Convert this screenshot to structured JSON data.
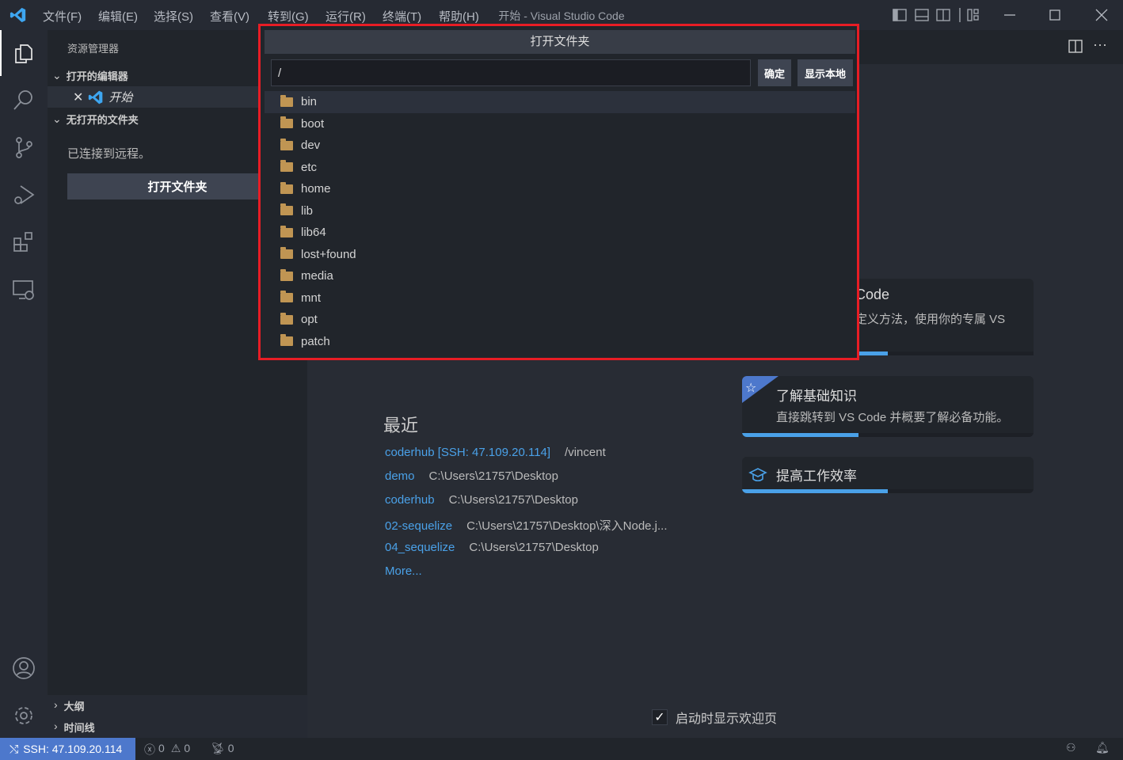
{
  "titlebar": {
    "menus": [
      "文件(F)",
      "编辑(E)",
      "选择(S)",
      "查看(V)",
      "转到(G)",
      "运行(R)",
      "终端(T)",
      "帮助(H)"
    ],
    "title": "开始 - Visual Studio Code"
  },
  "sidebar": {
    "title": "资源管理器",
    "open_editors": "打开的编辑器",
    "open_file": "开始",
    "no_folder": "无打开的文件夹",
    "connected": "已连接到远程。",
    "open_folder_btn": "打开文件夹",
    "outline": "大纲",
    "timeline": "时间线"
  },
  "dialog": {
    "title": "打开文件夹",
    "path": "/",
    "ok": "确定",
    "show_local": "显示本地",
    "items": [
      "bin",
      "boot",
      "dev",
      "etc",
      "home",
      "lib",
      "lib64",
      "lost+found",
      "media",
      "mnt",
      "opt",
      "patch"
    ]
  },
  "welcome": {
    "recent_title": "最近",
    "recent": [
      {
        "name": "coderhub [SSH: 47.109.20.114]",
        "path": "/vincent"
      },
      {
        "name": "demo",
        "path": "C:\\Users\\21757\\Desktop"
      },
      {
        "name": "coderhub",
        "path": "C:\\Users\\21757\\Desktop"
      },
      {
        "name": "02-sequelize",
        "path": "C:\\Users\\21757\\Desktop\\深入Node.j..."
      },
      {
        "name": "04_sequelize",
        "path": "C:\\Users\\21757\\Desktop"
      }
    ],
    "more": "More...",
    "cards": [
      {
        "title": "Code",
        "desc": "定义方法，使用你的专属 VS",
        "progress": 0.5
      },
      {
        "title": "了解基础知识",
        "desc": "直接跳转到 VS Code 并概要了解必备功能。",
        "progress": 0.4
      },
      {
        "title": "提高工作效率",
        "desc": "",
        "progress": 0.5
      }
    ],
    "show_on_startup": "启动时显示欢迎页",
    "show_on_startup_checked": true
  },
  "status": {
    "remote": "SSH: 47.109.20.114",
    "errors": "0",
    "warnings": "0",
    "ports": "0"
  },
  "colors": {
    "accent": "#4d78cc",
    "link": "#4aa1e8",
    "highlight": "#e81d25"
  }
}
